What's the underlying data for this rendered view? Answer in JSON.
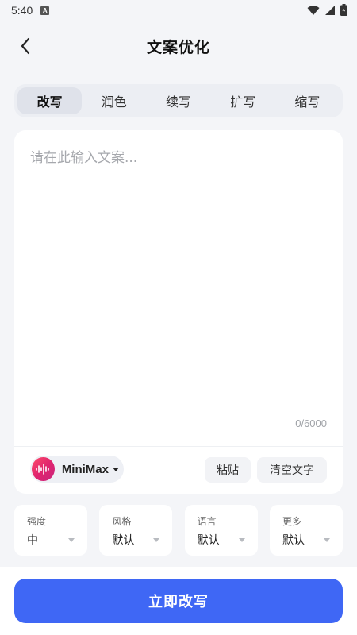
{
  "status_bar": {
    "time": "5:40",
    "notification_icon_letter": "A"
  },
  "header": {
    "title": "文案优化"
  },
  "tabs": [
    {
      "label": "改写",
      "active": true
    },
    {
      "label": "润色",
      "active": false
    },
    {
      "label": "续写",
      "active": false
    },
    {
      "label": "扩写",
      "active": false
    },
    {
      "label": "缩写",
      "active": false
    }
  ],
  "editor": {
    "value": "",
    "placeholder": "请在此输入文案...",
    "char_count": "0/6000"
  },
  "model": {
    "name": "MiniMax"
  },
  "actions": {
    "paste_label": "粘贴",
    "clear_label": "清空文字"
  },
  "options": [
    {
      "label": "强度",
      "value": "中"
    },
    {
      "label": "风格",
      "value": "默认"
    },
    {
      "label": "语言",
      "value": "默认"
    },
    {
      "label": "更多",
      "value": "默认"
    }
  ],
  "submit": {
    "label": "立即改写"
  },
  "colors": {
    "accent": "#3f67f5",
    "background": "#f4f5f8",
    "model_logo": "#e0246e"
  }
}
